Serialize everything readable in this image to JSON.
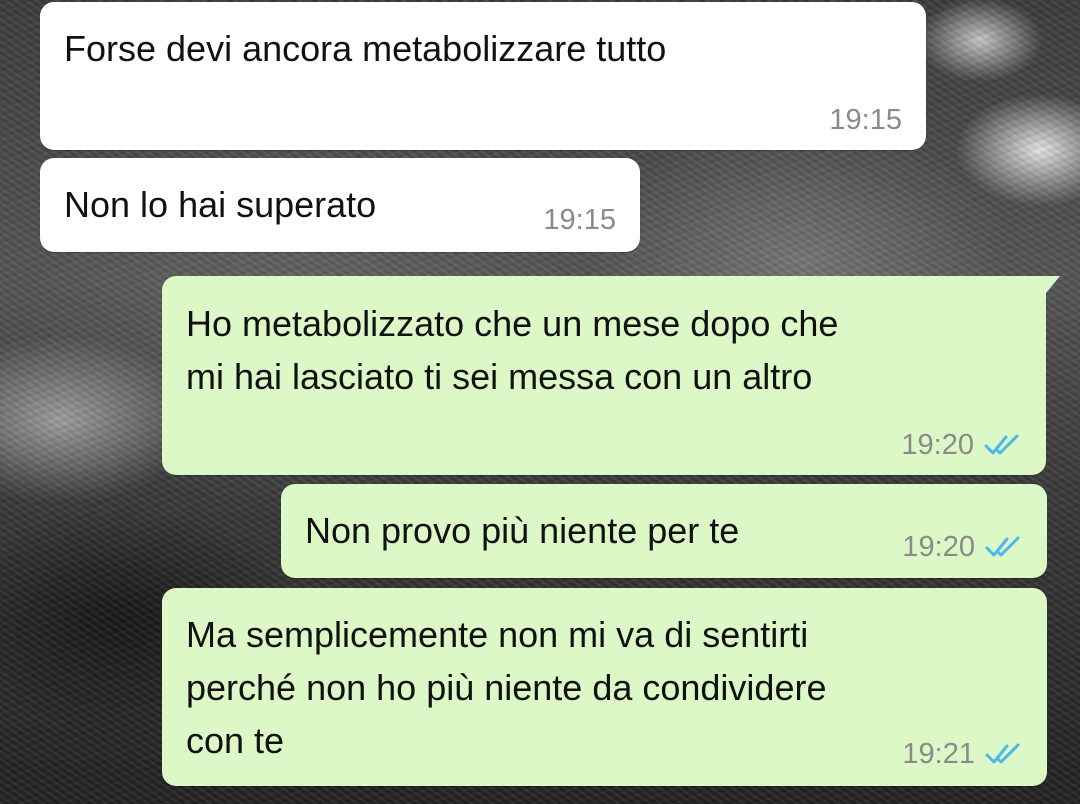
{
  "messages": [
    {
      "direction": "incoming",
      "text": "Forse devi ancora metabolizzare tutto",
      "time": "19:15"
    },
    {
      "direction": "incoming",
      "text": "Non lo hai superato",
      "time": "19:15"
    },
    {
      "direction": "outgoing",
      "text": "Ho metabolizzato che un mese dopo che\nmi hai lasciato ti sei messa con un altro",
      "time": "19:20",
      "status_icon": "double-check-read-icon"
    },
    {
      "direction": "outgoing",
      "text": "Non provo più niente per te",
      "time": "19:20",
      "status_icon": "double-check-read-icon"
    },
    {
      "direction": "outgoing",
      "text": "Ma semplicemente non mi va di sentirti\nperché non ho più niente da condividere\ncon te",
      "time": "19:21",
      "status_icon": "double-check-read-icon"
    }
  ],
  "colors": {
    "incoming_bubble": "#ffffff",
    "outgoing_bubble": "#dcf8c6",
    "timestamp": "#8a8a8a",
    "read_ticks": "#4fb6ec"
  }
}
